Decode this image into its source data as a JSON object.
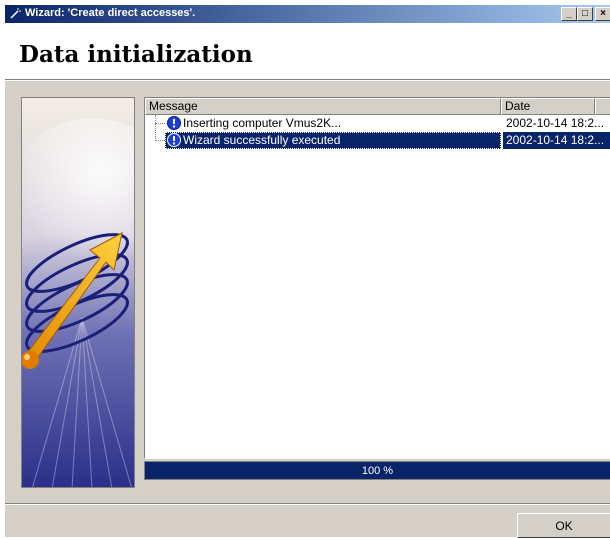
{
  "window": {
    "title": "Wizard: 'Create direct accesses'.",
    "minimize_glyph": "_",
    "maximize_glyph": "□",
    "close_glyph": "×"
  },
  "header": {
    "title": "Data initialization"
  },
  "list": {
    "columns": [
      "Message",
      "Date"
    ],
    "rows": [
      {
        "message": "Inserting computer Vmus2K...",
        "date": "2002-10-14 18:2...",
        "icon": "info-icon",
        "selected": false
      },
      {
        "message": "Wizard successfully executed",
        "date": "2002-10-14 18:2...",
        "icon": "info-icon",
        "selected": true
      }
    ]
  },
  "progress": {
    "label": "100 %",
    "value": 100
  },
  "buttons": {
    "ok_label": "OK"
  },
  "colors": {
    "title_bar": "#0a246a",
    "selection": "#0a246a",
    "progress_fill": "#0a246a",
    "dialog_face": "#d4d0c8",
    "info_icon": "#1c3fd6"
  }
}
